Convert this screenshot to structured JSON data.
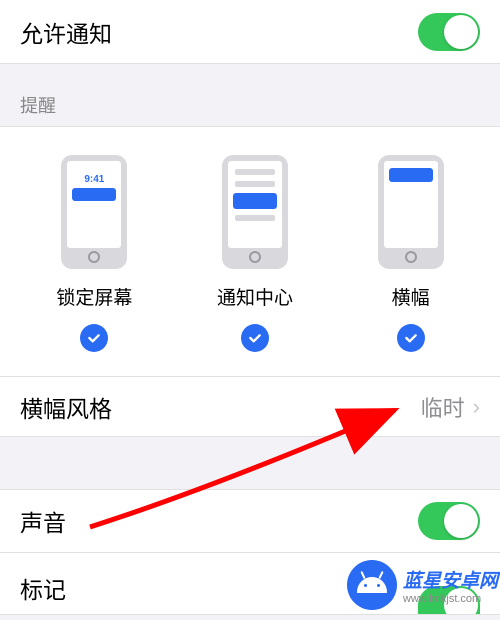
{
  "allowNotifications": {
    "label": "允许通知",
    "enabled": true
  },
  "alertsSection": {
    "header": "提醒",
    "options": [
      {
        "key": "lock",
        "label": "锁定屏幕",
        "time": "9:41",
        "checked": true
      },
      {
        "key": "center",
        "label": "通知中心",
        "checked": true
      },
      {
        "key": "banner",
        "label": "横幅",
        "checked": true
      }
    ]
  },
  "bannerStyle": {
    "label": "横幅风格",
    "value": "临时"
  },
  "sound": {
    "label": "声音",
    "enabled": true
  },
  "badge": {
    "label": "标记",
    "enabled": true
  },
  "watermark": {
    "title": "蓝星安卓网",
    "url": "www.lmkjst.com"
  }
}
